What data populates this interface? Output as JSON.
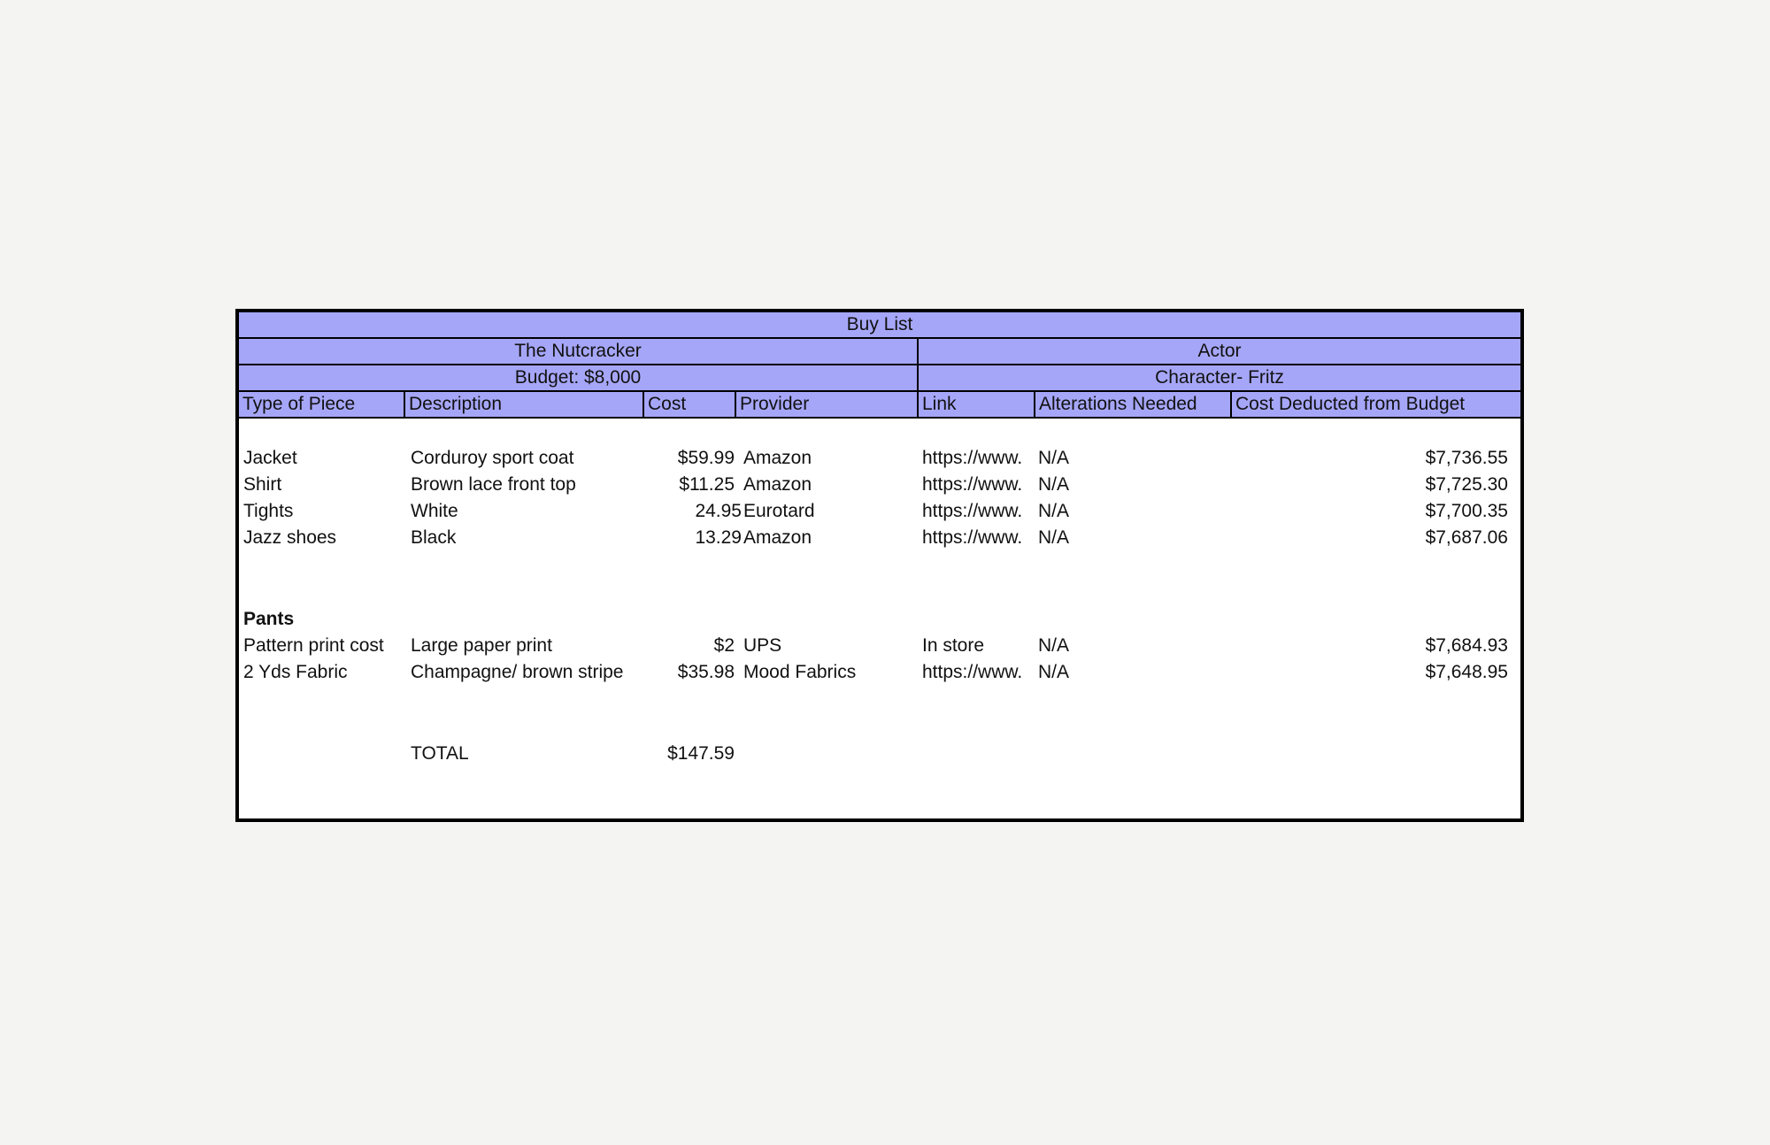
{
  "sheet": {
    "title": "Buy List",
    "show": "The Nutcracker",
    "actor_label": "Actor",
    "budget": "Budget: $8,000",
    "character": "Character- Fritz",
    "columns": [
      "Type of Piece",
      "Description",
      "Cost",
      "Provider",
      "Link",
      "Alterations Needed",
      "Cost Deducted from Budget"
    ],
    "items": [
      {
        "type": "Jacket",
        "description": "Corduroy sport coat",
        "cost": "$59.99",
        "provider": "Amazon",
        "link": "https://www.",
        "alterations": "N/A",
        "remaining": "$7,736.55"
      },
      {
        "type": "Shirt",
        "description": "Brown lace front top",
        "cost": "$11.25",
        "provider": "Amazon",
        "link": "https://www.",
        "alterations": "N/A",
        "remaining": "$7,725.30"
      },
      {
        "type": "Tights",
        "description": "White",
        "cost": "24.95",
        "provider": "Eurotard",
        "link": "https://www.",
        "alterations": "N/A",
        "remaining": "$7,700.35"
      },
      {
        "type": "Jazz shoes",
        "description": "Black",
        "cost": "13.29",
        "provider": "Amazon",
        "link": "https://www.",
        "alterations": "N/A",
        "remaining": "$7,687.06"
      }
    ],
    "section_label": "Pants",
    "section_items": [
      {
        "type": "Pattern print cost",
        "description": "Large paper print",
        "cost": "$2",
        "provider": "UPS",
        "link": "In store",
        "alterations": "N/A",
        "remaining": "$7,684.93"
      },
      {
        "type": "2 Yds Fabric",
        "description": "Champagne/ brown stripe",
        "cost": "$35.98",
        "provider": "Mood Fabrics",
        "link": "https://www.",
        "alterations": "N/A",
        "remaining": "$7,648.95"
      }
    ],
    "total_label": "TOTAL",
    "total_value": "$147.59"
  }
}
